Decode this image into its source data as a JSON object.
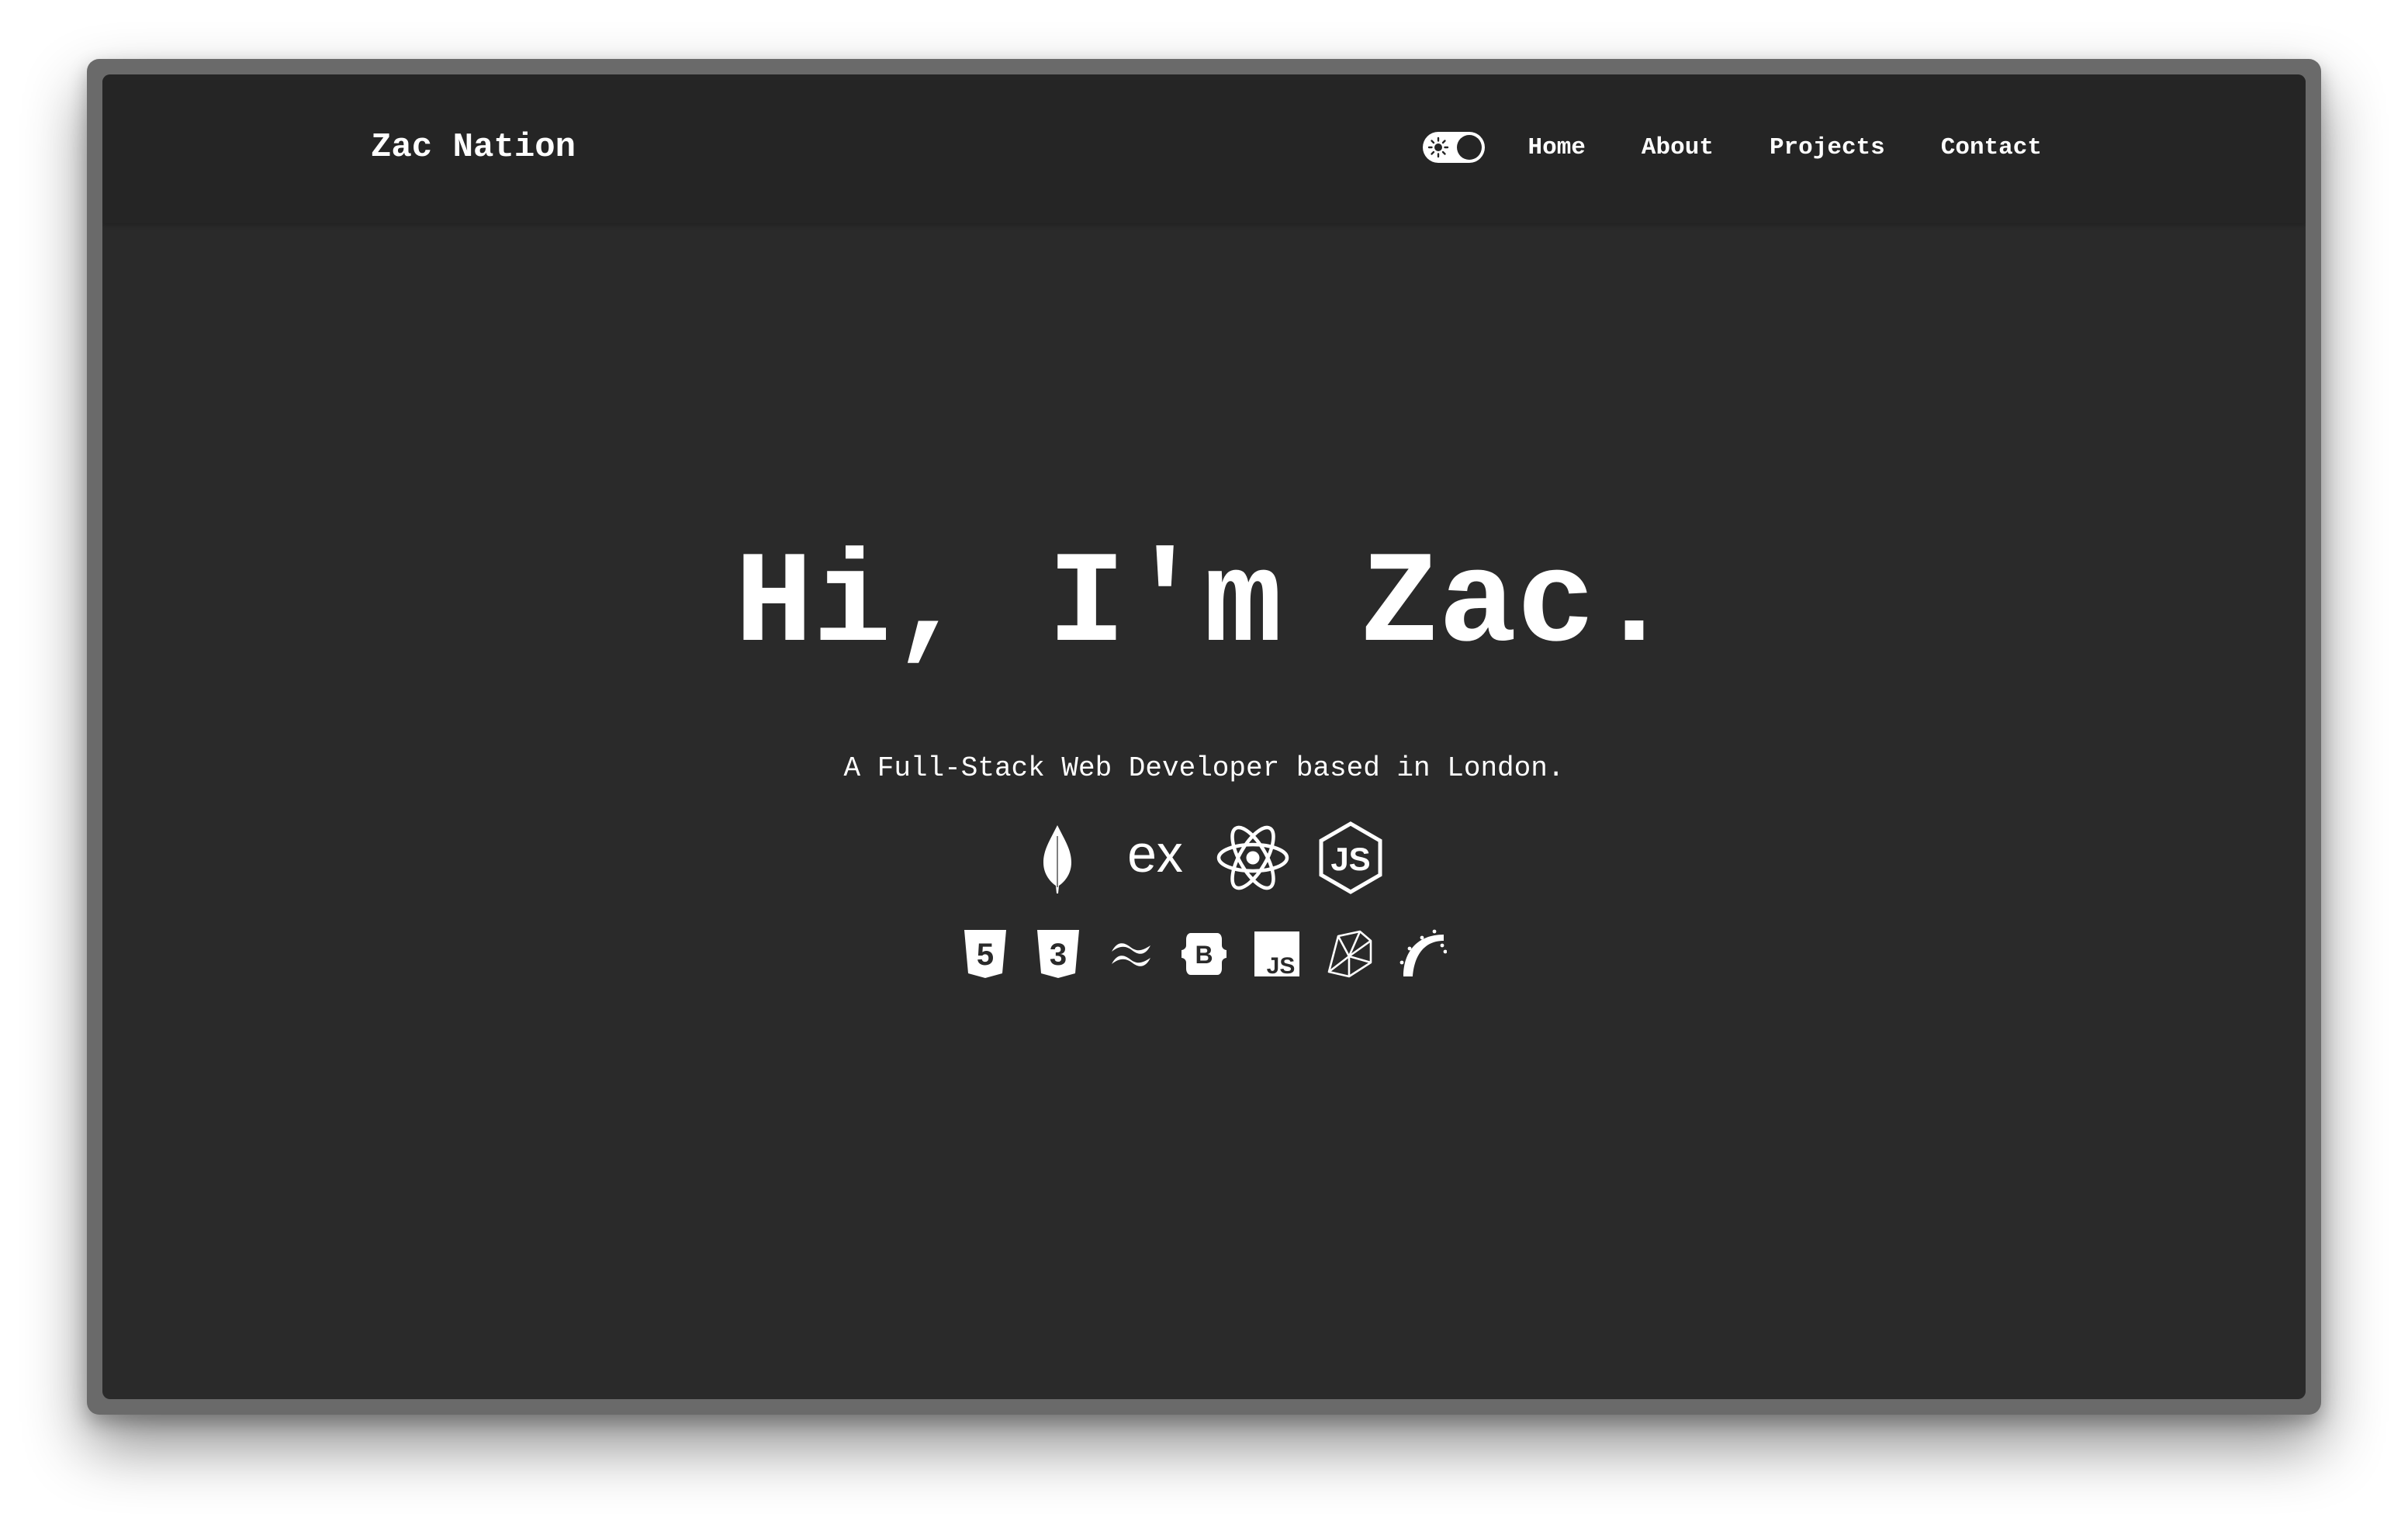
{
  "navbar": {
    "brand": "Zac Nation",
    "theme_toggle": {
      "state": "dark",
      "icon": "sun-icon"
    },
    "links": [
      {
        "label": "Home"
      },
      {
        "label": "About"
      },
      {
        "label": "Projects"
      },
      {
        "label": "Contact"
      }
    ]
  },
  "hero": {
    "title": "Hi, I'm Zac.",
    "subtitle": "A Full-Stack Web Developer based in London.",
    "stack_icons_primary": [
      "mongodb-icon",
      "express-icon",
      "react-icon",
      "nodejs-icon"
    ],
    "stack_icons_secondary": [
      "html5-icon",
      "css3-icon",
      "tailwind-icon",
      "bootstrap-icon",
      "javascript-icon",
      "ruby-icon",
      "rails-icon"
    ],
    "express_glyph": "ex",
    "javascript_glyph": "JS",
    "bootstrap_glyph": "B",
    "html5_glyph": "5",
    "css3_glyph": "3"
  },
  "colors": {
    "page_bg": "#2a2a2a",
    "navbar_bg": "#252525",
    "text": "#ffffff",
    "frame": "#6a6a6a"
  }
}
